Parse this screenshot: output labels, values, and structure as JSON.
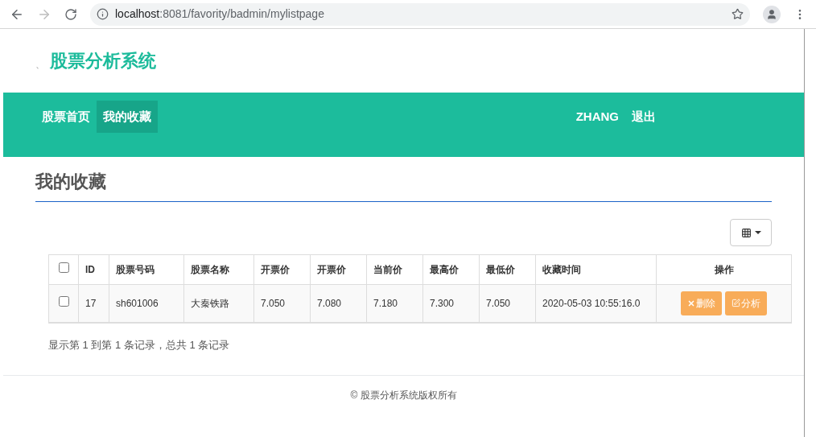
{
  "browser": {
    "url_host": "localhost",
    "url_rest": ":8081/favority/badmin/mylistpage"
  },
  "header": {
    "mark": "、",
    "title": "股票分析系统"
  },
  "nav": {
    "items": [
      {
        "label": "股票首页",
        "selected": false
      },
      {
        "label": "我的收藏",
        "selected": true
      }
    ],
    "user": "ZHANG",
    "logout": "退出"
  },
  "page_title": "我的收藏",
  "table": {
    "select_all_checked": false,
    "columns": [
      "ID",
      "股票号码",
      "股票名称",
      "开票价",
      "开票价",
      "当前价",
      "最高价",
      "最低价",
      "收藏时间",
      "操作"
    ],
    "rows": [
      {
        "checked": false,
        "cells": [
          "17",
          "sh601006",
          "大秦铁路",
          "7.050",
          "7.080",
          "7.180",
          "7.300",
          "7.050",
          "2020-05-03 10:55:16.0"
        ],
        "actions": [
          "删除",
          "分析"
        ]
      }
    ]
  },
  "pagination_info": "显示第 1 到第 1 条记录，总共 1 条记录",
  "footer": "© 股票分析系统版权所有"
}
